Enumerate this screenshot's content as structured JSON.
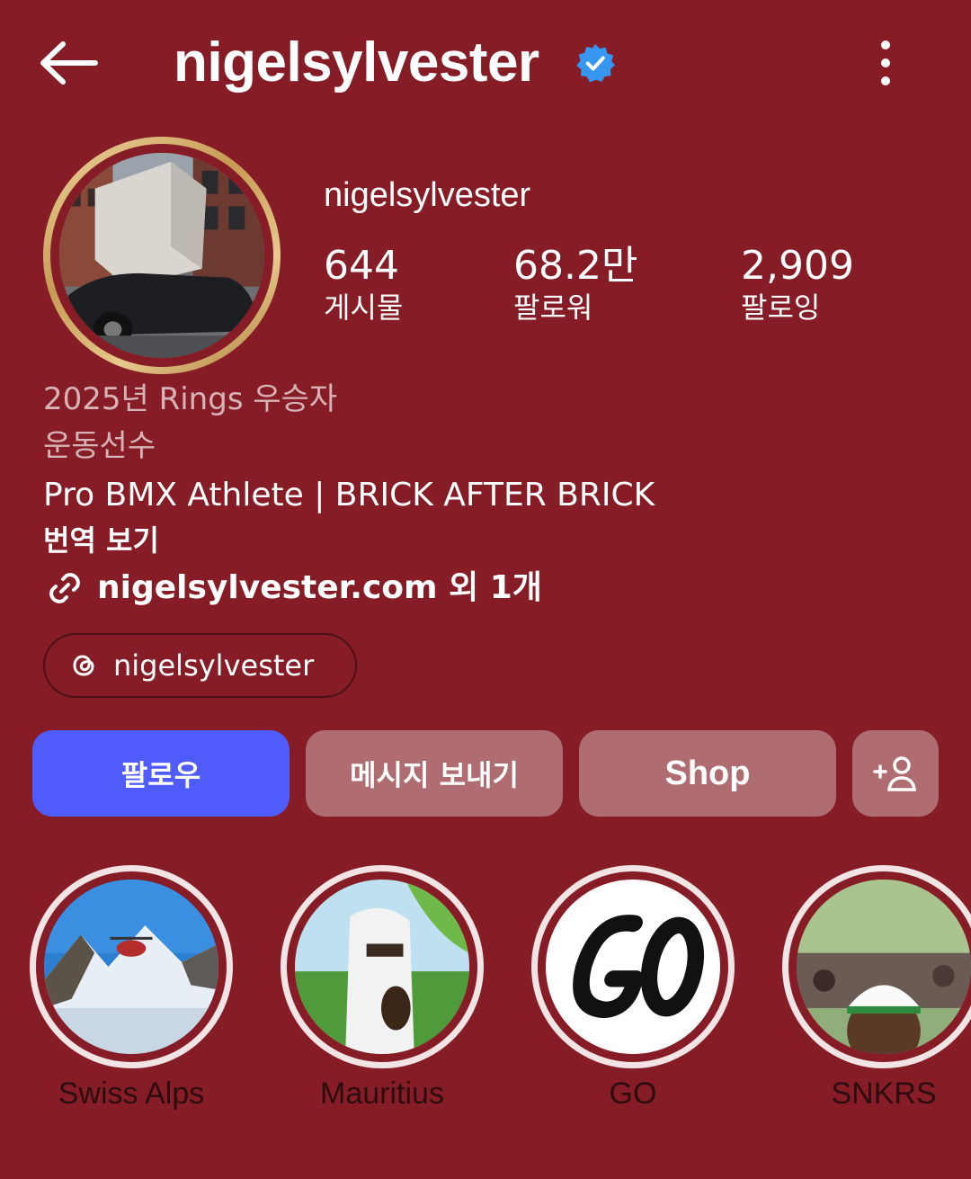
{
  "header": {
    "title": "nigelsylvester",
    "back_icon": "arrow-left-icon",
    "verified_icon": "verified-badge-icon",
    "menu_icon": "more-vertical-icon",
    "verified_color": "#3797f0"
  },
  "profile": {
    "name": "nigelsylvester",
    "stats": [
      {
        "value": "644",
        "label": "게시물"
      },
      {
        "value": "68.2만",
        "label": "팔로워"
      },
      {
        "value": "2,909",
        "label": "팔로잉"
      }
    ]
  },
  "bio": {
    "award": "2025년 Rings 우승자",
    "category": "운동선수",
    "text": "Pro BMX Athlete | BRICK AFTER BRICK",
    "translate": "번역 보기",
    "link_icon": "link-icon",
    "link": "nigelsylvester.com 외 1개",
    "threads_icon": "threads-icon",
    "threads_handle": "nigelsylvester"
  },
  "actions": {
    "follow": "팔로우",
    "message": "메시지 보내기",
    "shop": "Shop",
    "add_user_icon": "add-user-icon"
  },
  "colors": {
    "background": "#861d26",
    "follow_button": "#4f5cfb",
    "secondary_button": "#b06d71"
  },
  "highlights": [
    {
      "label": "Swiss Alps"
    },
    {
      "label": "Mauritius"
    },
    {
      "label": "GO"
    },
    {
      "label": "SNKRS"
    }
  ]
}
